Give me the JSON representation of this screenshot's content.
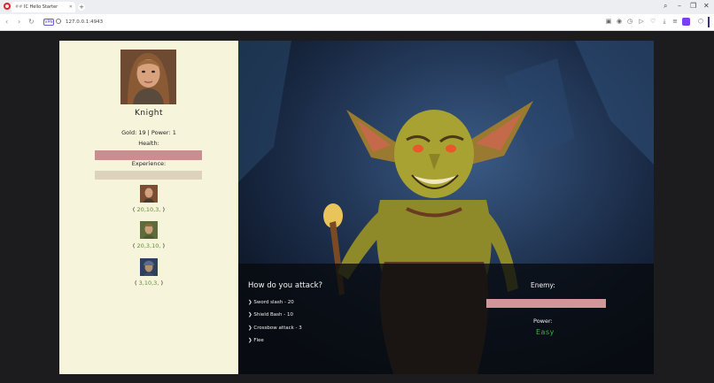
{
  "browser": {
    "tab_title": "IC Hello Starter",
    "tab_prefix": "##",
    "url": "127.0.0.1:4943",
    "vpn_label": "VPN"
  },
  "player": {
    "name": "Knight",
    "stats_text": "Gold: 19 | Power: 1",
    "health_label": "Health:",
    "health_fraction": 1.0,
    "experience_label": "Experience:",
    "experience_fraction": 0.0
  },
  "companions": [
    {
      "open": "(",
      "values": "20,10,3,",
      "close": ")"
    },
    {
      "open": "(",
      "values": "20,3,10,",
      "close": ")"
    },
    {
      "open": "(",
      "values": "3,10,3,",
      "close": ")"
    }
  ],
  "combat": {
    "prompt": "How do you attack?",
    "options": [
      "Sword slash - 20",
      "Shield Bash - 10",
      "Crossbow attack - 3",
      "Flee"
    ],
    "enemy_label": "Enemy:",
    "enemy_health_fraction": 1.0,
    "power_label": "Power:",
    "power_value": "Easy"
  },
  "colors": {
    "panel_bg": "#f6f5dc",
    "health": "#c88e90",
    "enemy_health": "#d09698",
    "power_value": "#3fb03f",
    "companion_numbers": "#5d8f2f"
  }
}
